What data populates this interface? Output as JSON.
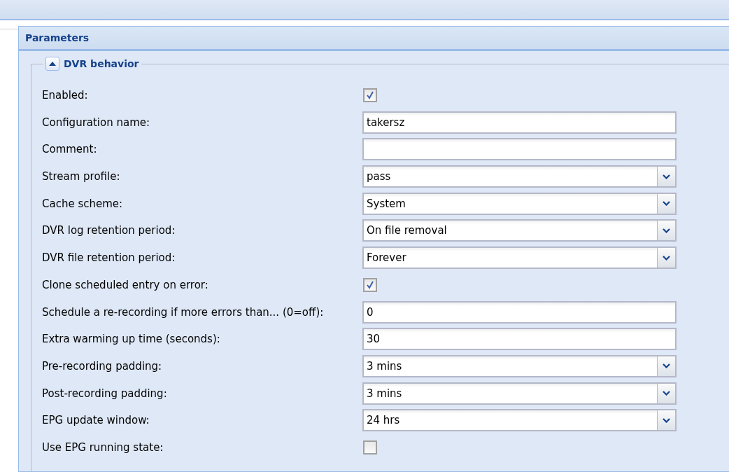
{
  "panel": {
    "title": "Parameters"
  },
  "section": {
    "title": "DVR behavior",
    "expanded": true
  },
  "fields": [
    {
      "kind": "checkbox",
      "label": "Enabled:",
      "checked": true
    },
    {
      "kind": "text",
      "label": "Configuration name:",
      "value": "takersz"
    },
    {
      "kind": "text",
      "label": "Comment:"
    },
    {
      "kind": "combo",
      "label": "Stream profile:",
      "value": "pass"
    },
    {
      "kind": "combo",
      "label": "Cache scheme:",
      "value": "System"
    },
    {
      "kind": "combo",
      "label": "DVR log retention period:",
      "value": "On file removal"
    },
    {
      "kind": "combo",
      "label": "DVR file retention period:",
      "value": "Forever"
    },
    {
      "kind": "checkbox",
      "label": "Clone scheduled entry on error:",
      "checked": true
    },
    {
      "kind": "text",
      "label": "Schedule a re-recording if more errors than... (0=off):",
      "value": "0"
    },
    {
      "kind": "text",
      "label": "Extra warming up time (seconds):",
      "value": "30"
    },
    {
      "kind": "combo",
      "label": "Pre-recording padding:",
      "value": "3 mins"
    },
    {
      "kind": "combo",
      "label": "Post-recording padding:",
      "value": "3 mins"
    },
    {
      "kind": "combo",
      "label": "EPG update window:",
      "value": "24 hrs"
    },
    {
      "kind": "checkbox",
      "label": "Use EPG running state:",
      "checked": false
    }
  ]
}
